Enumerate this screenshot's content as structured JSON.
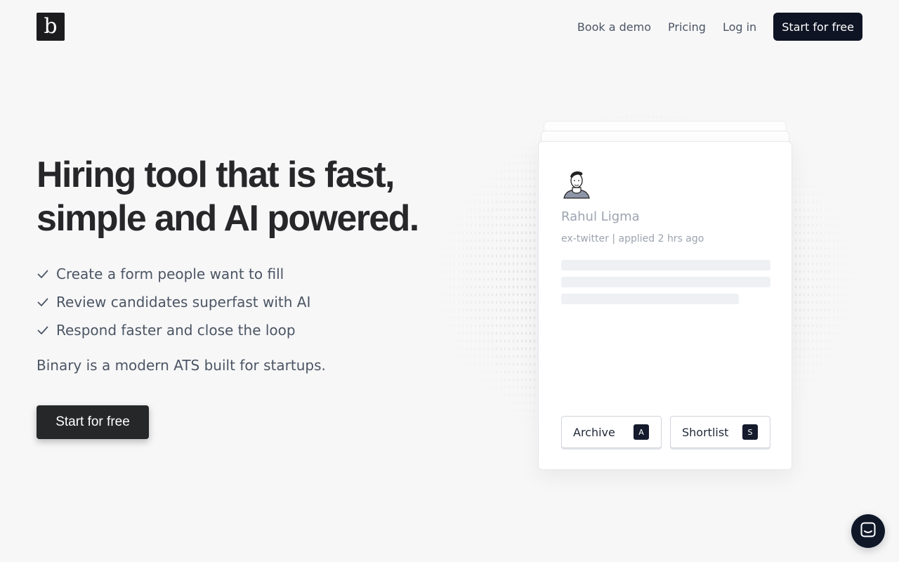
{
  "brand": {
    "logo_letter": "b"
  },
  "nav": {
    "items": [
      {
        "label": "Book a demo"
      },
      {
        "label": "Pricing"
      },
      {
        "label": "Log in"
      }
    ],
    "cta_label": "Start for free"
  },
  "hero": {
    "title_line1": "Hiring tool that is fast,",
    "title_line2": "simple and AI powered.",
    "features": [
      "Create a form people want to fill",
      "Review candidates superfast with AI",
      "Respond faster and close the loop"
    ],
    "tagline": "Binary is a modern ATS built for startups.",
    "cta_label": "Start for free"
  },
  "candidate_card": {
    "name": "Rahul Ligma",
    "meta": "ex-twitter | applied 2 hrs ago",
    "actions": [
      {
        "label": "Archive",
        "shortcut": "A"
      },
      {
        "label": "Shortlist",
        "shortcut": "S"
      }
    ]
  },
  "colors": {
    "background": "#f7f7f8",
    "primary_dark": "#0f1424",
    "hero_button": "#262729",
    "heading": "#27272a",
    "muted_text": "#4b5563"
  },
  "icons": [
    "check-icon",
    "avatar-illustration",
    "chat-icon"
  ]
}
